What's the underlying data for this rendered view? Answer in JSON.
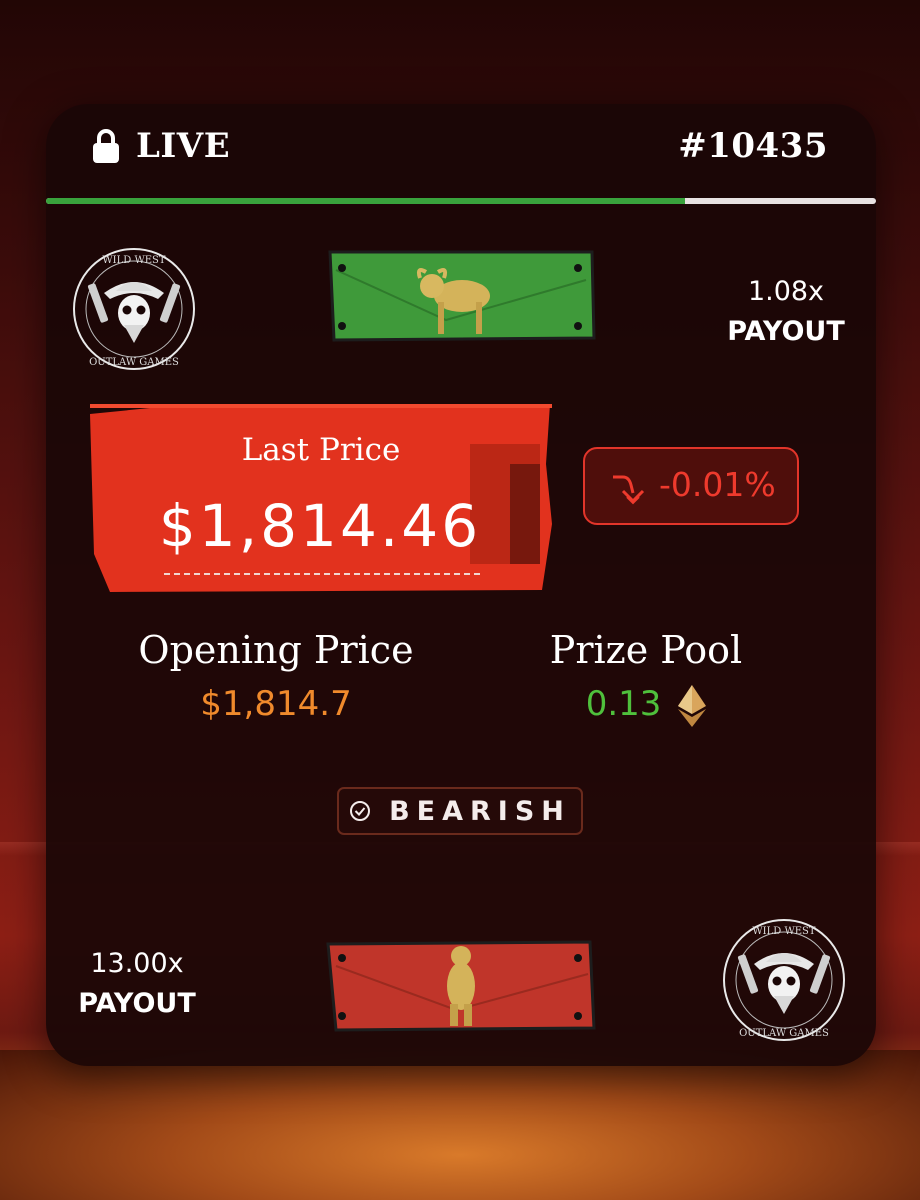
{
  "header": {
    "status": "LIVE",
    "round_id": "#10435",
    "progress_fraction": 0.77
  },
  "logos": {
    "top_text_upper": "WILD WEST",
    "top_text_lower": "OUTLAW GAMES"
  },
  "bull": {
    "payout_multiplier": "1.08x",
    "payout_label": "PAYOUT",
    "plate_color": "#3f9a3a",
    "icon": "bull-icon"
  },
  "bear": {
    "payout_multiplier": "13.00x",
    "payout_label": "PAYOUT",
    "plate_color": "#c0352a",
    "icon": "bear-icon"
  },
  "last_price": {
    "label": "Last Price",
    "value": "$1,814.46",
    "change": "-0.01%",
    "change_color": "#ee3a2d"
  },
  "opening_price": {
    "label": "Opening Price",
    "value": "$1,814.7",
    "color": "#f08a2c"
  },
  "prize_pool": {
    "label": "Prize Pool",
    "value": "0.13",
    "color": "#4fc03c",
    "icon": "eth-icon"
  },
  "selected_side": {
    "label": "BEARISH",
    "icon": "check-circle-icon"
  }
}
